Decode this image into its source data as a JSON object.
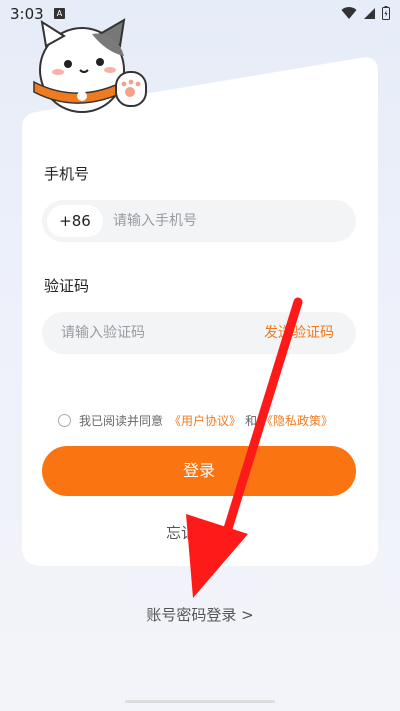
{
  "status_bar": {
    "time": "3:03",
    "notification_glyph": "A",
    "icons": [
      "wifi-icon",
      "signal-icon",
      "battery-icon"
    ]
  },
  "form": {
    "phone_label": "手机号",
    "country_code": "+86",
    "phone_placeholder": "请输入手机号",
    "code_label": "验证码",
    "code_placeholder": "请输入验证码",
    "send_code": "发送验证码"
  },
  "agreement": {
    "prefix": "我已阅读并同意",
    "user_agreement": "《用户协议》",
    "joiner": "和",
    "privacy_policy": "《隐私政策》"
  },
  "login_button": "登录",
  "forgot_password": "忘记密码?",
  "password_login": "账号密码登录 >",
  "colors": {
    "accent": "#fb7412",
    "link": "#f07b1f",
    "arrow": "#ff1a1a"
  }
}
